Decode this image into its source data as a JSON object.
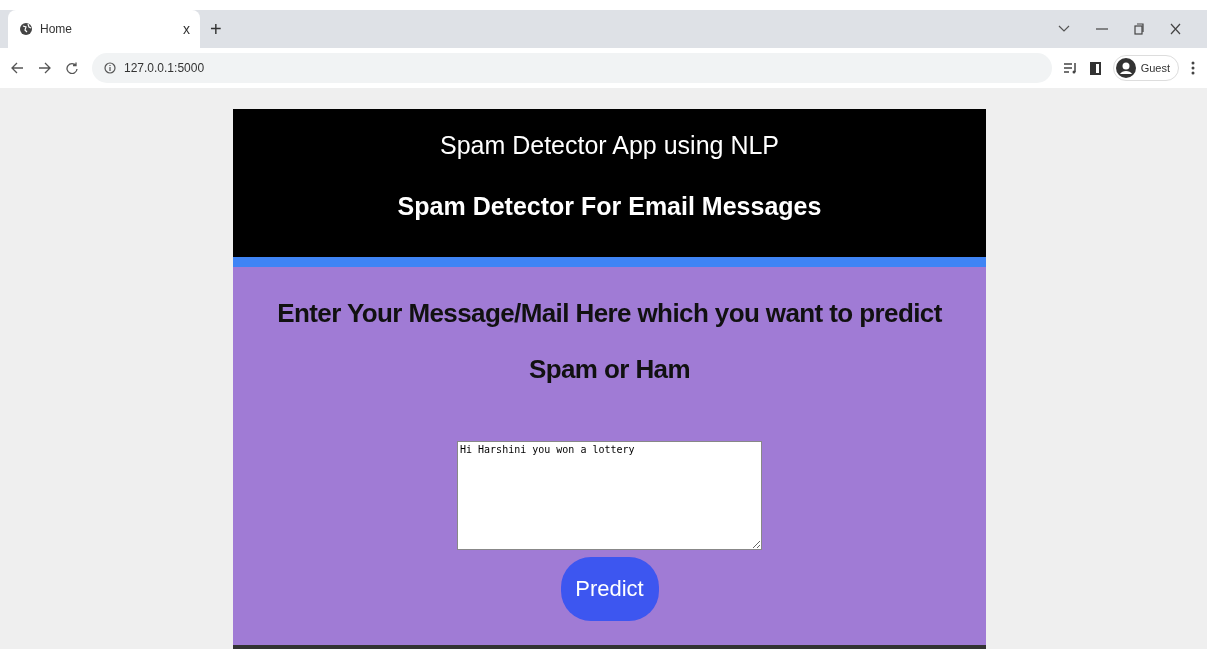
{
  "browser": {
    "tabs": [
      {
        "title": "Home",
        "close": "x",
        "selected": true
      }
    ],
    "new_tab": "+",
    "address": "127.0.0.1:5000",
    "profile": "Guest"
  },
  "page": {
    "header_title": "Spam Detector App using NLP",
    "header_subtitle": "Spam Detector For Email Messages",
    "prompt": "Enter Your Message/Mail Here which you want to predict Spam or Ham",
    "message": {
      "value": "Hi Harshini you won a lottery"
    },
    "predict_button": "Predict"
  }
}
